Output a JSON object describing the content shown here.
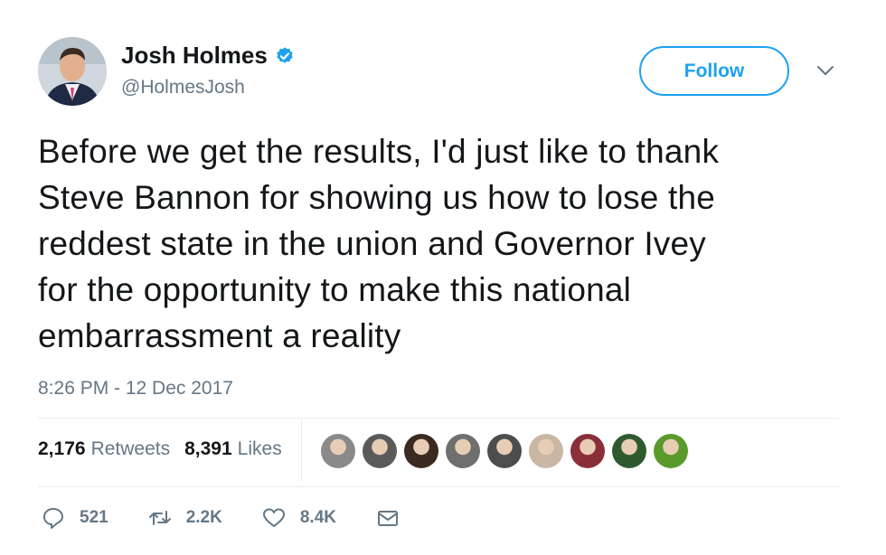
{
  "author": {
    "name": "Josh Holmes",
    "handle": "@HolmesJosh",
    "verified_icon": "verified-badge-icon"
  },
  "follow_label": "Follow",
  "tweet": {
    "lines": [
      "Before we get the results, I'd just like to thank",
      "Steve Bannon for showing us how to lose the",
      "reddest state in the union and Governor Ivey",
      "for the opportunity to make this national",
      "embarrassment a reality"
    ],
    "timestamp": "8:26 PM - 12 Dec 2017"
  },
  "stats": {
    "retweets_count": "2,176",
    "retweets_label": "Retweets",
    "likes_count": "8,391",
    "likes_label": "Likes"
  },
  "likers": [
    {
      "color": "#8a8a8a"
    },
    {
      "color": "#5a5a5a"
    },
    {
      "color": "#3b2a22"
    },
    {
      "color": "#6f6f6f"
    },
    {
      "color": "#4d4d4d"
    },
    {
      "color": "#c9b7a4"
    },
    {
      "color": "#8a2f3a"
    },
    {
      "color": "#2f5a2f"
    },
    {
      "color": "#5a9a2a"
    }
  ],
  "actions": {
    "reply_count": "521",
    "retweet_count": "2.2K",
    "like_count": "8.4K"
  },
  "colors": {
    "accent": "#1da1f2",
    "secondary_text": "#657786",
    "divider": "#e6ecf0"
  }
}
